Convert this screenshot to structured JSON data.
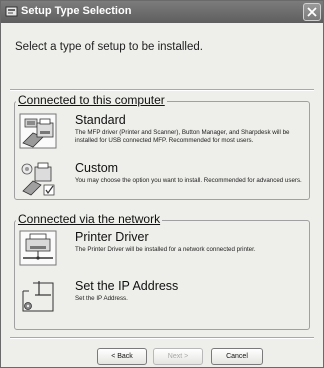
{
  "window": {
    "title": "Setup Type Selection",
    "close_symbol": "×"
  },
  "headline": "Select a type of setup to be installed.",
  "groups": [
    {
      "title": "Connected to this computer",
      "options": [
        {
          "title": "Standard",
          "description": "The MFP driver (Printer and Scanner), Button Manager, and Sharpdesk will be installed for USB connected MFP.  Recommended for most users.",
          "icon": "standard-install-icon"
        },
        {
          "title": "Custom",
          "description": "You may choose the option you want to install. Recommended for advanced users.",
          "icon": "custom-install-icon"
        }
      ]
    },
    {
      "title": "Connected via the network",
      "options": [
        {
          "title": "Printer Driver",
          "description": "The Printer Driver will be installed for a network connected printer.",
          "icon": "network-printer-icon"
        },
        {
          "title": "Set the IP Address",
          "description": "Set the IP Address.",
          "icon": "ip-address-icon"
        }
      ]
    }
  ],
  "buttons": {
    "back": "< Back",
    "next": "Next >",
    "cancel": "Cancel"
  }
}
